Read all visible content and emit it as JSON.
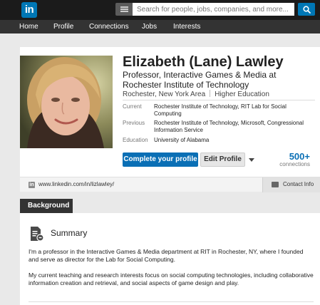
{
  "header": {
    "logo_text": "in",
    "search": {
      "placeholder": "Search for people, jobs, companies, and more...",
      "menu_icon": "menu-icon",
      "button_icon": "search-icon"
    },
    "nav": [
      {
        "label": "Home"
      },
      {
        "label": "Profile"
      },
      {
        "label": "Connections"
      },
      {
        "label": "Jobs"
      },
      {
        "label": "Interests"
      }
    ]
  },
  "profile": {
    "name": "Elizabeth (Lane) Lawley",
    "headline": "Professor, Interactive Games & Media at Rochester Institute of Technology",
    "location": "Rochester, New York Area",
    "industry": "Higher Education",
    "info": [
      {
        "label": "Current",
        "value": "Rochester Institute of Technology, RIT Lab for Social Computing"
      },
      {
        "label": "Previous",
        "value": "Rochester Institute of Technology, Microsoft, Congressional Information Service"
      },
      {
        "label": "Education",
        "value": "University of Alabama"
      }
    ],
    "primary_button": "Complete your profile",
    "secondary_button": "Edit Profile",
    "connections_count": "500+",
    "connections_label": "connections",
    "public_url": "www.linkedin.com/in/lizlawley/",
    "contact_info": "Contact Info"
  },
  "background": {
    "tab_label": "Background",
    "summary_title": "Summary",
    "summary_paragraphs": [
      "I'm a professor in the Interactive Games & Media department at RIT in Rochester, NY, where I founded and serve as director for the Lab for Social Computing.",
      "My current teaching and research interests focus on social computing technologies, including collaborative information creation and retrieval, and social aspects of game design and play."
    ]
  },
  "colors": {
    "brand": "#0077b5",
    "primary_button": "#0a6fb5",
    "topbar": "#1b1b1b",
    "navbar": "#333333"
  }
}
